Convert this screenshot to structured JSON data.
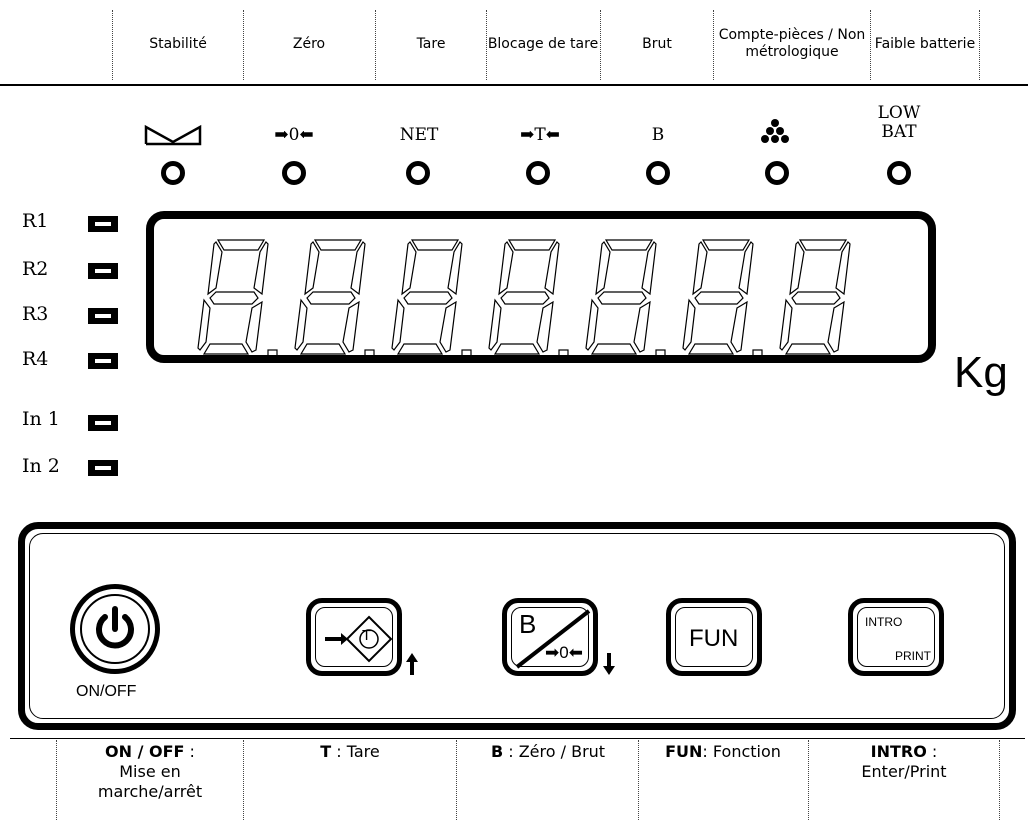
{
  "top_labels": [
    {
      "id": "stabilite",
      "text": "Stabilité"
    },
    {
      "id": "zero",
      "text": "Zéro"
    },
    {
      "id": "tare",
      "text": "Tare"
    },
    {
      "id": "blocage",
      "text": "Blocage de tare"
    },
    {
      "id": "brut",
      "text": "Brut"
    },
    {
      "id": "compte",
      "text": "Compte-pièces / Non métrologique"
    },
    {
      "id": "batterie",
      "text": "Faible batterie"
    }
  ],
  "indicators": {
    "zero_symbol": "➡0⬅",
    "net_symbol": "NET",
    "tare_block_symbol": "➡T⬅",
    "brut_symbol": "B",
    "low_bat_line1": "LOW",
    "low_bat_line2": "BAT"
  },
  "side_leds": [
    "R1",
    "R2",
    "R3",
    "R4",
    "In 1",
    "In 2"
  ],
  "display": {
    "digit_count": 7,
    "unit": "Kg"
  },
  "keys": {
    "onoff_label": "ON/OFF",
    "tare_key_letter": "T",
    "zero_key_letter": "B",
    "zero_key_sub": "➡0⬅",
    "fun_label": "FUN",
    "intro_label": "INTRO",
    "print_label": "PRINT"
  },
  "bottom_labels": [
    {
      "key": "ON / OFF",
      "sep": " :",
      "desc": "Mise en marche/arrêt"
    },
    {
      "key": "T",
      "sep": " : ",
      "desc": "Tare"
    },
    {
      "key": "B",
      "sep": " : ",
      "desc": "Zéro / Brut"
    },
    {
      "key": "FUN",
      "sep": ": ",
      "desc": "Fonction"
    },
    {
      "key": "INTRO",
      "sep": " :",
      "desc": "Enter/Print"
    }
  ]
}
